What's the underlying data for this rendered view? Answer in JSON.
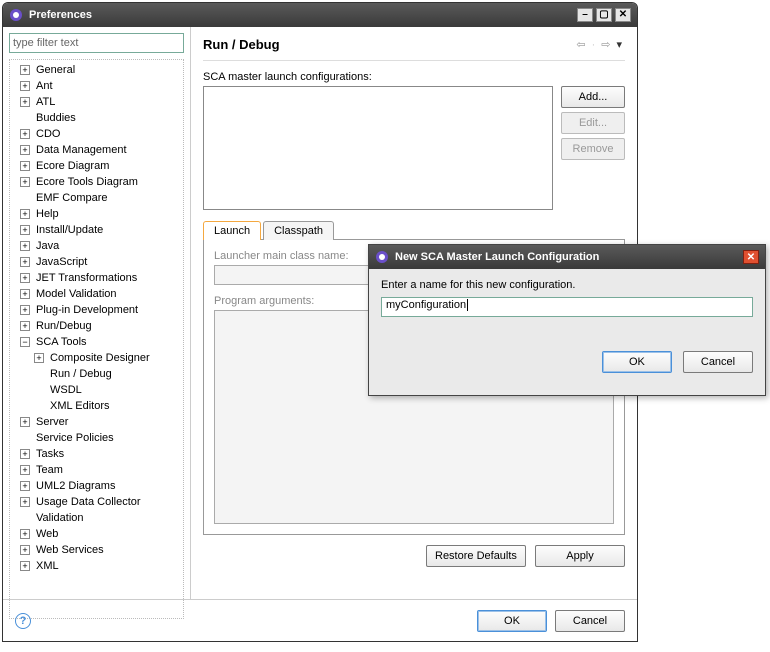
{
  "window": {
    "title": "Preferences",
    "filter_placeholder": "type filter text"
  },
  "tree": [
    {
      "label": "General",
      "exp": "+"
    },
    {
      "label": "Ant",
      "exp": "+"
    },
    {
      "label": "ATL",
      "exp": "+"
    },
    {
      "label": "Buddies",
      "exp": ""
    },
    {
      "label": "CDO",
      "exp": "+"
    },
    {
      "label": "Data Management",
      "exp": "+"
    },
    {
      "label": "Ecore Diagram",
      "exp": "+"
    },
    {
      "label": "Ecore Tools Diagram",
      "exp": "+"
    },
    {
      "label": "EMF Compare",
      "exp": ""
    },
    {
      "label": "Help",
      "exp": "+"
    },
    {
      "label": "Install/Update",
      "exp": "+"
    },
    {
      "label": "Java",
      "exp": "+"
    },
    {
      "label": "JavaScript",
      "exp": "+"
    },
    {
      "label": "JET Transformations",
      "exp": "+"
    },
    {
      "label": "Model Validation",
      "exp": "+"
    },
    {
      "label": "Plug-in Development",
      "exp": "+"
    },
    {
      "label": "Run/Debug",
      "exp": "+"
    },
    {
      "label": "SCA Tools",
      "exp": "-",
      "children": [
        {
          "label": "Composite Designer",
          "exp": "+"
        },
        {
          "label": "Run / Debug",
          "exp": ""
        },
        {
          "label": "WSDL",
          "exp": ""
        },
        {
          "label": "XML Editors",
          "exp": ""
        }
      ]
    },
    {
      "label": "Server",
      "exp": "+"
    },
    {
      "label": "Service Policies",
      "exp": ""
    },
    {
      "label": "Tasks",
      "exp": "+"
    },
    {
      "label": "Team",
      "exp": "+"
    },
    {
      "label": "UML2 Diagrams",
      "exp": "+"
    },
    {
      "label": "Usage Data Collector",
      "exp": "+"
    },
    {
      "label": "Validation",
      "exp": ""
    },
    {
      "label": "Web",
      "exp": "+"
    },
    {
      "label": "Web Services",
      "exp": "+"
    },
    {
      "label": "XML",
      "exp": "+"
    }
  ],
  "page": {
    "title": "Run / Debug",
    "configs_label": "SCA master launch configurations:",
    "add_label": "Add...",
    "edit_label": "Edit...",
    "remove_label": "Remove",
    "tabs": {
      "launch": "Launch",
      "classpath": "Classpath"
    },
    "launcher_main_class_label": "Launcher main class name:",
    "program_args_label": "Program arguments:",
    "restore_defaults_label": "Restore Defaults",
    "apply_label": "Apply"
  },
  "footer": {
    "ok_label": "OK",
    "cancel_label": "Cancel"
  },
  "dialog": {
    "title": "New SCA Master Launch Configuration",
    "prompt": "Enter a name for this new configuration.",
    "value": "myConfiguration",
    "ok_label": "OK",
    "cancel_label": "Cancel"
  }
}
